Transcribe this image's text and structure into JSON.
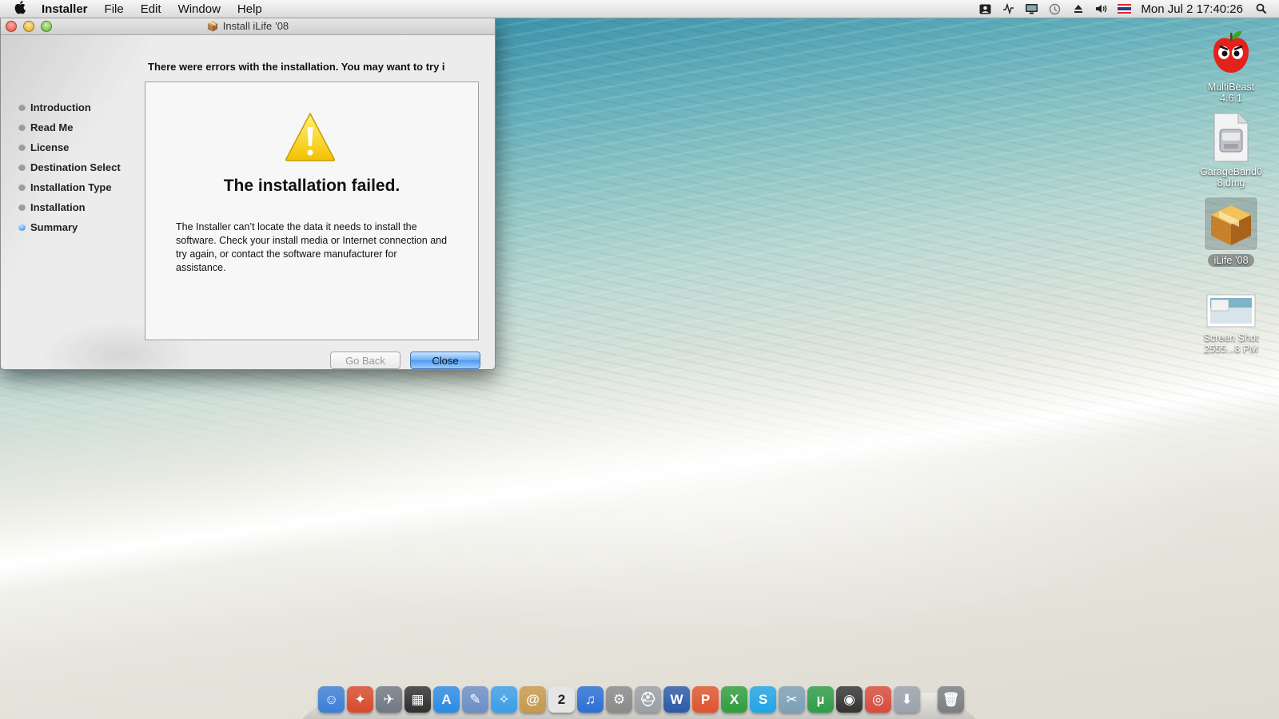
{
  "menubar": {
    "app_name": "Installer",
    "items": [
      "File",
      "Edit",
      "Window",
      "Help"
    ],
    "clock": "Mon Jul 2  17:40:26",
    "status_icons": [
      "user-icon",
      "activity-icon",
      "display-icon",
      "time-machine-icon",
      "eject-icon",
      "volume-icon",
      "flag-icon"
    ]
  },
  "window": {
    "title": "Install iLife ’08",
    "header": "There were errors with the installation. You may want to try i",
    "steps": [
      {
        "label": "Introduction",
        "active": false
      },
      {
        "label": "Read Me",
        "active": false
      },
      {
        "label": "License",
        "active": false
      },
      {
        "label": "Destination Select",
        "active": false
      },
      {
        "label": "Installation Type",
        "active": false
      },
      {
        "label": "Installation",
        "active": false
      },
      {
        "label": "Summary",
        "active": true
      }
    ],
    "fail_title": "The installation failed.",
    "fail_message": "The Installer can’t locate the data it needs to install the software. Check your install media or Internet connection and try again, or contact the software manufacturer for assistance.",
    "buttons": {
      "go_back": "Go Back",
      "close": "Close"
    }
  },
  "desktop_icons": [
    {
      "line1": "MultiBeast",
      "line2": "4.6.1",
      "icon": "multibeast-icon"
    },
    {
      "line1": "GarageBand0",
      "line2": "8.dmg",
      "icon": "disk-image-icon"
    },
    {
      "line1": "iLife ’08",
      "line2": "",
      "icon": "package-icon"
    },
    {
      "line1": "Screen Shot",
      "line2": "2555...8 PM",
      "icon": "screenshot-file-icon"
    }
  ],
  "dock_items": [
    {
      "name": "finder-icon",
      "glyph": "☺",
      "color": "#3b7fd8"
    },
    {
      "name": "cleaner-icon",
      "glyph": "✦",
      "color": "#d84a2c"
    },
    {
      "name": "launchpad-icon",
      "glyph": "✈",
      "color": "#6f7884"
    },
    {
      "name": "mission-control-icon",
      "glyph": "▦",
      "color": "#2f2f2f"
    },
    {
      "name": "app-store-icon",
      "glyph": "A",
      "color": "#2a8be6"
    },
    {
      "name": "preview-icon",
      "glyph": "✎",
      "color": "#6b8fc7"
    },
    {
      "name": "safari-icon",
      "glyph": "✧",
      "color": "#3a9ee8"
    },
    {
      "name": "contacts-icon",
      "glyph": "@",
      "color": "#c69a4e"
    },
    {
      "name": "calendar-icon",
      "glyph": "2",
      "color": "#e6e6e6"
    },
    {
      "name": "itunes-icon",
      "glyph": "♫",
      "color": "#2a6fd6"
    },
    {
      "name": "system-preferences-icon",
      "glyph": "⚙",
      "color": "#8a8a8a"
    },
    {
      "name": "disk-utility-icon",
      "glyph": "⛑",
      "color": "#9aa0a6"
    },
    {
      "name": "word-icon",
      "glyph": "W",
      "color": "#2b5aa8"
    },
    {
      "name": "powerpoint-icon",
      "glyph": "P",
      "color": "#e0542e"
    },
    {
      "name": "excel-icon",
      "glyph": "X",
      "color": "#2f9e3e"
    },
    {
      "name": "skype-icon",
      "glyph": "S",
      "color": "#1fa5e8"
    },
    {
      "name": "image-tools-icon",
      "glyph": "✂",
      "color": "#7ca0b8"
    },
    {
      "name": "utorrent-icon",
      "glyph": "µ",
      "color": "#2d9d47"
    },
    {
      "name": "photo-booth-icon",
      "glyph": "◉",
      "color": "#333333"
    },
    {
      "name": "chrome-icon",
      "glyph": "◎",
      "color": "#d94b3c"
    },
    {
      "name": "downloads-icon",
      "glyph": "⬇",
      "color": "#9aa3ad"
    },
    {
      "name": "trash-icon",
      "glyph": "🗑",
      "color": "#7b7f84"
    }
  ]
}
